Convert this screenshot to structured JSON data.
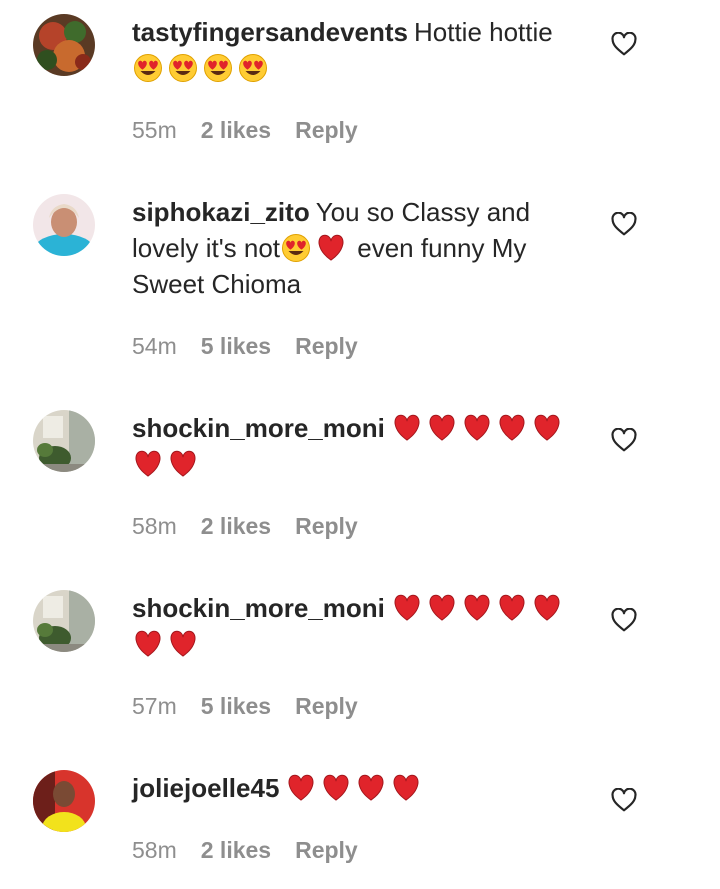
{
  "comments": [
    {
      "username": "tastyfingersandevents",
      "text": "Hottie hottie",
      "emojis": [
        "heart-eyes",
        "heart-eyes",
        "heart-eyes",
        "heart-eyes"
      ],
      "text_after": "",
      "time": "55m",
      "likes": "2 likes",
      "reply": "Reply"
    },
    {
      "username": "siphokazi_zito",
      "text": "You so Classy and lovely it's not",
      "emojis": [
        "heart-eyes",
        "red-heart"
      ],
      "text_after": "even funny My Sweet Chioma",
      "time": "54m",
      "likes": "5 likes",
      "reply": "Reply"
    },
    {
      "username": "shockin_more_moni",
      "text": "",
      "emojis": [
        "red-heart",
        "red-heart",
        "red-heart",
        "red-heart",
        "red-heart",
        "red-heart",
        "red-heart"
      ],
      "text_after": "",
      "time": "58m",
      "likes": "2 likes",
      "reply": "Reply"
    },
    {
      "username": "shockin_more_moni",
      "text": "",
      "emojis": [
        "red-heart",
        "red-heart",
        "red-heart",
        "red-heart",
        "red-heart",
        "red-heart",
        "red-heart"
      ],
      "text_after": "",
      "time": "57m",
      "likes": "5 likes",
      "reply": "Reply"
    },
    {
      "username": "joliejoelle45",
      "text": "",
      "emojis": [
        "red-heart",
        "red-heart",
        "red-heart",
        "red-heart"
      ],
      "text_after": "",
      "time": "58m",
      "likes": "2 likes",
      "reply": "Reply"
    }
  ],
  "icons": {
    "like": "heart-outline-icon"
  },
  "colors": {
    "text": "#262626",
    "meta": "#8e8e8e",
    "heart_red": "#e0242b"
  }
}
